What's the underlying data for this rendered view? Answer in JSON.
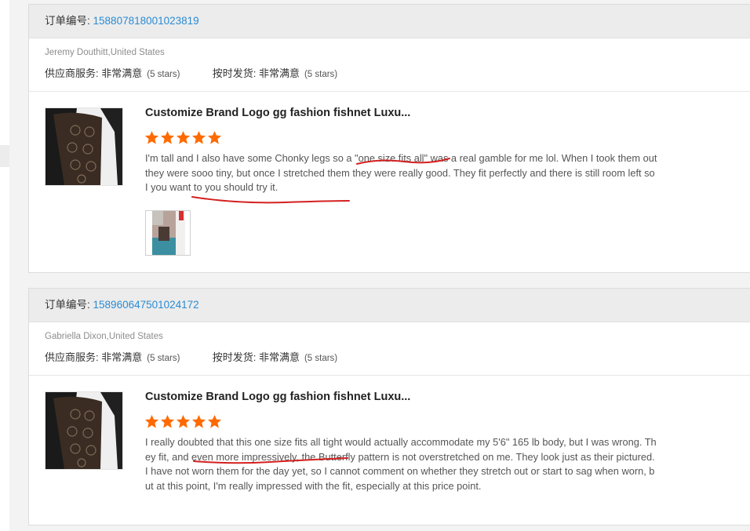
{
  "orders": [
    {
      "order_label": "订单编号:",
      "order_number": "158807818001023819",
      "buyer": "Jeremy Douthitt,United States",
      "supplier_service_label": "供应商服务:",
      "supplier_service_value": "非常满意",
      "supplier_service_stars": "(5 stars)",
      "shipping_label": "按时发货:",
      "shipping_value": "非常满意",
      "shipping_stars": "(5 stars)",
      "product_title": "Customize Brand Logo gg fashion fishnet Luxu...",
      "rating": 5,
      "review_text": "I'm tall and I also have some Chonky legs so a \"one size fits all\" was a real gamble for me lol. When I took them out they were sooo tiny, but once I stretched them they were really good. They fit perfectly and there is still room left so I you want to you should try it."
    },
    {
      "order_label": "订单编号:",
      "order_number": "158960647501024172",
      "buyer": "Gabriella Dixon,United States",
      "supplier_service_label": "供应商服务:",
      "supplier_service_value": "非常满意",
      "supplier_service_stars": "(5 stars)",
      "shipping_label": "按时发货:",
      "shipping_value": "非常满意",
      "shipping_stars": "(5 stars)",
      "product_title": "Customize Brand Logo gg fashion fishnet Luxu...",
      "rating": 5,
      "review_text": "I really doubted that this one size fits all tight would actually accommodate my 5'6\" 165 lb body, but I was wrong. They fit, and even more impressively, the Butterfly pattern is not overstretched on me. They look just as their pictured. I have not worn them for the day yet, so I cannot comment on whether they stretch out or start to sag when worn, but at this point, I'm really impressed with the fit, especially at this price point."
    }
  ],
  "colors": {
    "order_link": "#2b8bd3",
    "star": "#ff6a00",
    "annotation": "#d42020"
  },
  "icons": {
    "star": "star-icon"
  }
}
